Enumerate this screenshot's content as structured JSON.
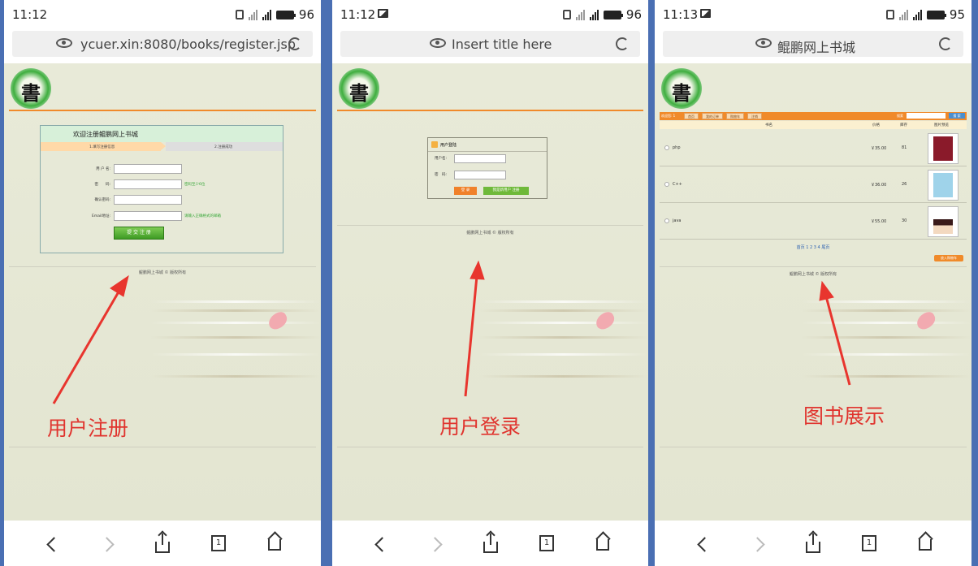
{
  "status_bars": [
    {
      "time": "11:12",
      "battery": "96"
    },
    {
      "time": "11:12",
      "battery": "96"
    },
    {
      "time": "11:13",
      "battery": "95"
    }
  ],
  "address": [
    "ycuer.xin:8080/books/register.jsp",
    "Insert title here",
    "鲲鹏网上书城"
  ],
  "logo_char": "書",
  "register": {
    "welcome": "欢迎注册鲲鹏网上书城",
    "step1": "1.填写注册信息",
    "step2": "2.注册成功",
    "username_label": "用 户 名:",
    "password_label": "密　　码:",
    "password_hint": "密码至少6位",
    "confirm_label": "确认密码:",
    "email_label": "Email地址:",
    "email_hint": "请输入正确格式的邮箱",
    "submit": "提 交 注 册",
    "footer": "鲲鹏网上书城 © 版权所有",
    "caption": "用户注册"
  },
  "login": {
    "title": "用户登陆",
    "username_label": "用户名:",
    "password_label": "密　码:",
    "login_btn": "登 录",
    "register_btn": "我是新用户 注册",
    "footer": "鲲鹏网上书城 © 版权所有",
    "caption": "用户登录"
  },
  "books": {
    "welcome": "欢迎您: 1",
    "nav": [
      "首页",
      "我的订单",
      "购物车",
      "注销"
    ],
    "search_label": "搜索",
    "search_btn": "搜 索",
    "col_name": "书名",
    "col_price": "价格",
    "col_stock": "库存",
    "col_cover": "图片预览",
    "rows": [
      {
        "name": "php",
        "price": "￥35.00",
        "stock": "81",
        "cover": "#8a1a2a"
      },
      {
        "name": "C++",
        "price": "￥36.00",
        "stock": "26",
        "cover": "#9fd3ea"
      },
      {
        "name": "java",
        "price": "￥55.00",
        "stock": "30",
        "cover": "#3a1a1a"
      }
    ],
    "pager": "首页  1  2  3  4  尾页",
    "buy": "放入购物车",
    "footer": "鲲鹏网上书城 © 版权所有",
    "caption": "图书展示"
  }
}
